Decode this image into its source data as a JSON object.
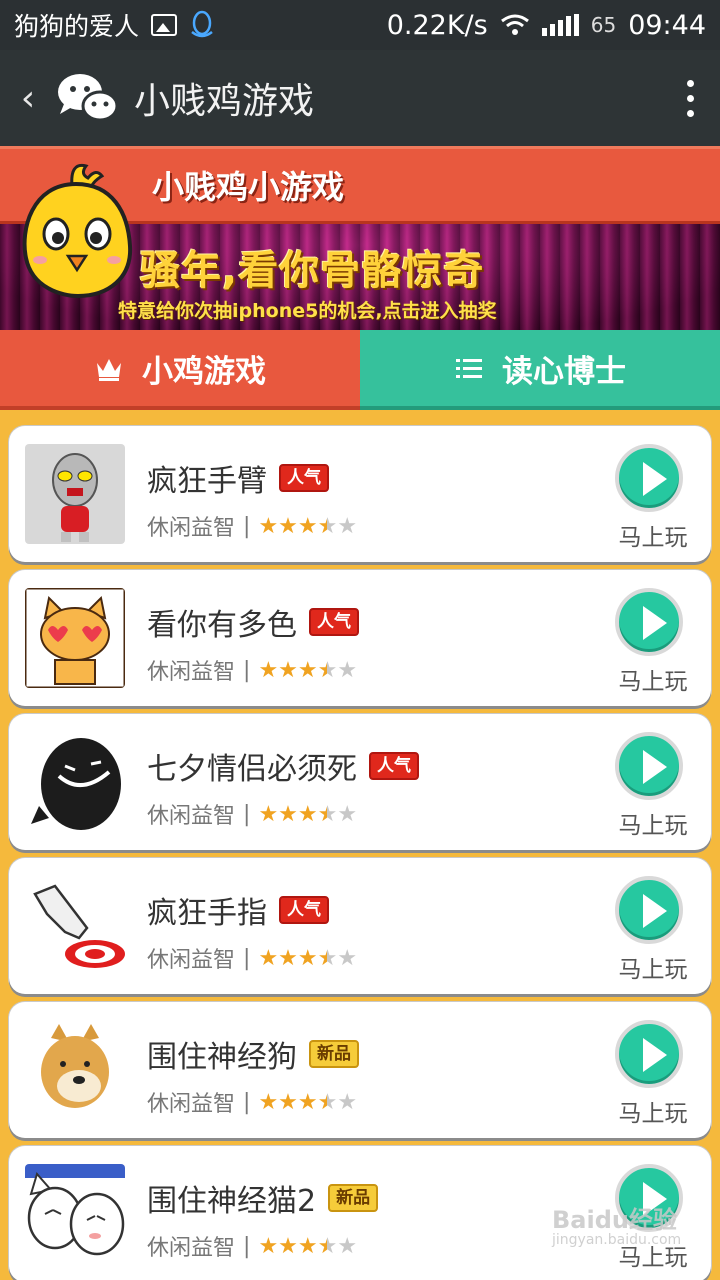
{
  "status_bar": {
    "carrier_text": "狗狗的爱人",
    "speed": "0.22K/s",
    "battery": "65",
    "time": "09:44"
  },
  "title_bar": {
    "title": "小贱鸡游戏",
    "back_glyph": "‹"
  },
  "banner": {
    "heading": "小贱鸡小游戏",
    "slogan": "骚年,看你骨骼惊奇",
    "subtext": "特意给你次抽iphone5的机会,点击进入抽奖"
  },
  "tabs": [
    {
      "label": "小鸡游戏",
      "icon": "crown-icon"
    },
    {
      "label": "读心博士",
      "icon": "list-icon"
    }
  ],
  "games": [
    {
      "name": "疯狂手臂",
      "badge": "人气",
      "badge_type": "hot",
      "category": "休闲益智",
      "rating": 3.5,
      "play_label": "马上玩"
    },
    {
      "name": "看你有多色",
      "badge": "人气",
      "badge_type": "hot",
      "category": "休闲益智",
      "rating": 3.5,
      "play_label": "马上玩"
    },
    {
      "name": "七夕情侣必须死",
      "badge": "人气",
      "badge_type": "hot",
      "category": "休闲益智",
      "rating": 3.5,
      "play_label": "马上玩"
    },
    {
      "name": "疯狂手指",
      "badge": "人气",
      "badge_type": "hot",
      "category": "休闲益智",
      "rating": 3.5,
      "play_label": "马上玩"
    },
    {
      "name": "围住神经狗",
      "badge": "新品",
      "badge_type": "new",
      "category": "休闲益智",
      "rating": 3.5,
      "play_label": "马上玩"
    },
    {
      "name": "围住神经猫2",
      "badge": "新品",
      "badge_type": "new",
      "category": "休闲益智",
      "rating": 3.5,
      "play_label": "马上玩"
    }
  ],
  "separator": "|",
  "watermark": {
    "text": "Baidu经验",
    "sub": "jingyan.baidu.com"
  },
  "colors": {
    "accent_red": "#e8583e",
    "accent_green": "#36c19c",
    "background": "#f5b93c",
    "play_button": "#26c8a0",
    "star": "#f0a321"
  }
}
